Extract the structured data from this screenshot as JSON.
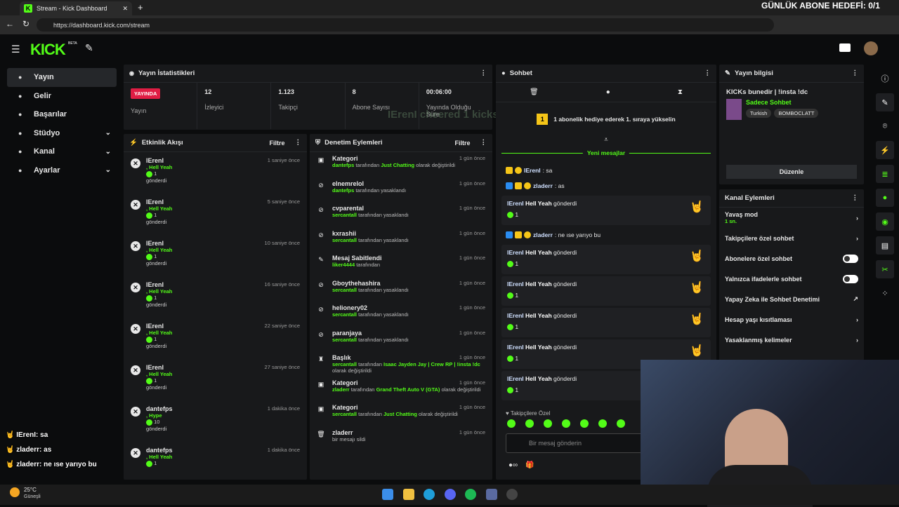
{
  "browser": {
    "tab_title": "Stream - Kick Dashboard",
    "url": "https://dashboard.kick.com/stream"
  },
  "overlay_top": "GÜNLÜK ABONE HEDEFİ: 0/1",
  "overlay_ghost": "IErenI cheered 1 kicks!",
  "logo": "KICK",
  "logo_beta": "BETA",
  "sidebar": [
    {
      "label": "Yayın",
      "icon": "broadcast-icon"
    },
    {
      "label": "Gelir",
      "icon": "wallet-icon"
    },
    {
      "label": "Başarılar",
      "icon": "trophy-icon"
    },
    {
      "label": "Stüdyo",
      "icon": "studio-icon",
      "chev": "⌄"
    },
    {
      "label": "Kanal",
      "icon": "channel-icon",
      "chev": "⌄"
    },
    {
      "label": "Ayarlar",
      "icon": "settings-icon",
      "chev": "⌄"
    }
  ],
  "stats": {
    "title": "Yayın İstatistikleri",
    "live_badge": "YAYINDA",
    "status_label": "Yayın",
    "items": [
      {
        "value": "12",
        "label": "İzleyici"
      },
      {
        "value": "1.123",
        "label": "Takipçi"
      },
      {
        "value": "8",
        "label": "Abone Sayısı"
      },
      {
        "value": "00:06:00",
        "label": "Yayında Olduğu Süre"
      }
    ]
  },
  "activity": {
    "title": "Etkinlik Akışı",
    "filter": "Filtre",
    "events": [
      {
        "name": "IErenI",
        "gift": ", Hell Yeah",
        "count": "1",
        "sent": "gönderdi",
        "time": "1 saniye önce"
      },
      {
        "name": "IErenI",
        "gift": ", Hell Yeah",
        "count": "1",
        "sent": "gönderdi",
        "time": "5 saniye önce"
      },
      {
        "name": "IErenI",
        "gift": ", Hell Yeah",
        "count": "1",
        "sent": "gönderdi",
        "time": "10 saniye önce"
      },
      {
        "name": "IErenI",
        "gift": ", Hell Yeah",
        "count": "1",
        "sent": "gönderdi",
        "time": "16 saniye önce"
      },
      {
        "name": "IErenI",
        "gift": ", Hell Yeah",
        "count": "1",
        "sent": "gönderdi",
        "time": "22 saniye önce"
      },
      {
        "name": "IErenI",
        "gift": ", Hell Yeah",
        "count": "1",
        "sent": "gönderdi",
        "time": "27 saniye önce"
      },
      {
        "name": "dantefps",
        "gift": ", Hype",
        "count": "10",
        "sent": "gönderdi",
        "time": "1 dakika önce"
      },
      {
        "name": "dantefps",
        "gift": ", Hell Yeah",
        "count": "1",
        "sent": "",
        "time": "1 dakika önce"
      }
    ]
  },
  "moderation": {
    "title": "Denetim Eylemleri",
    "filter": "Filtre",
    "actions": [
      {
        "icon": "▣",
        "name": "Kategori",
        "by": "dantefps",
        "text": " tarafından ",
        "hl": "Just Chatting",
        "tail": " olarak değiştirildi",
        "time": "1 gün önce"
      },
      {
        "icon": "⊘",
        "name": "elnemrelol",
        "by": "dantefps",
        "text": " tarafından yasaklandı",
        "hl": "",
        "tail": "",
        "time": "1 gün önce"
      },
      {
        "icon": "⊘",
        "name": "cvparental",
        "by": "sercantall",
        "text": " tarafından yasaklandı",
        "hl": "",
        "tail": "",
        "time": "1 gün önce"
      },
      {
        "icon": "⊘",
        "name": "kxrashii",
        "by": "sercantall",
        "text": " tarafından yasaklandı",
        "hl": "",
        "tail": "",
        "time": "1 gün önce"
      },
      {
        "icon": "✎",
        "name": "Mesaj Sabitlendi",
        "by": "liker4444",
        "text": " tarafından",
        "hl": "",
        "tail": "",
        "time": "1 gün önce"
      },
      {
        "icon": "⊘",
        "name": "Gboythehashira",
        "by": "sercantall",
        "text": " tarafından yasaklandı",
        "hl": "",
        "tail": "",
        "time": "1 gün önce"
      },
      {
        "icon": "⊘",
        "name": "helionery02",
        "by": "sercantall",
        "text": " tarafından yasaklandı",
        "hl": "",
        "tail": "",
        "time": "1 gün önce"
      },
      {
        "icon": "⊘",
        "name": "paranjaya",
        "by": "sercantall",
        "text": " tarafından yasaklandı",
        "hl": "",
        "tail": "",
        "time": "1 gün önce"
      },
      {
        "icon": "♜",
        "name": "Başlık",
        "by": "sercantall",
        "text": " tarafından ",
        "hl": "Isaac Jayden Jay | Crew RP | !insta !dc",
        "tail": " olarak değiştirildi",
        "time": "1 gün önce"
      },
      {
        "icon": "▣",
        "name": "Kategori",
        "by": "zladerr",
        "text": " tarafından ",
        "hl": "Grand Theft Auto V (GTA)",
        "tail": " olarak değiştirildi",
        "time": "1 gün önce"
      },
      {
        "icon": "▣",
        "name": "Kategori",
        "by": "sercantall",
        "text": " tarafından ",
        "hl": "Just Chatting",
        "tail": " olarak değiştirildi",
        "time": "1 gün önce"
      },
      {
        "icon": "🗑",
        "name": "zladerr",
        "by": "",
        "text": "bir mesajı sildi",
        "hl": "",
        "tail": "",
        "time": "1 gün önce"
      }
    ]
  },
  "chat": {
    "title": "Sohbet",
    "gift_banner": "1 abonelik hediye ederek 1. sıraya yükselin",
    "gift_rank": "1",
    "new_messages": "Yeni mesajlar",
    "messages": [
      {
        "user": "IErenI",
        "text": ": sa"
      },
      {
        "user": "zladerr",
        "text": ": as"
      }
    ],
    "gift_cards": [
      {
        "user": "IErenI",
        "item": "Hell Yeah",
        "verb": "gönderdi",
        "count": "1"
      }
    ],
    "mid_message": {
      "user": "zladerr",
      "text": ": ne ıse yarıyo bu"
    },
    "gift_cards2": [
      {
        "user": "IErenI",
        "item": "Hell Yeah",
        "verb": "gönderdi",
        "count": "1"
      },
      {
        "user": "IErenI",
        "item": "Hell Yeah",
        "verb": "gönderdi",
        "count": "1"
      },
      {
        "user": "IErenI",
        "item": "Hell Yeah",
        "verb": "gönderdi",
        "count": "1"
      },
      {
        "user": "IErenI",
        "item": "Hell Yeah",
        "verb": "gönderdi",
        "count": "1"
      },
      {
        "user": "IErenI",
        "item": "Hell Yeah",
        "verb": "gönderdi",
        "count": "1"
      }
    ],
    "followers_label": "Takipçilere Özel",
    "input_placeholder": "Bir mesaj gönderin"
  },
  "stream_info": {
    "title": "Yayın bilgisi",
    "stream_title": "KICKs bunedir | !insta !dc",
    "category": "Sadece Sohbet",
    "tags": [
      "Turkish",
      "BOMBOCLATT"
    ],
    "edit": "Düzenle"
  },
  "channel_actions": {
    "title": "Kanal Eylemleri",
    "items": [
      {
        "label": "Yavaş mod",
        "sub": "1 sn.",
        "type": "chev"
      },
      {
        "label": "Takipçilere özel sohbet",
        "sub": "",
        "type": "chev"
      },
      {
        "label": "Abonelere özel sohbet",
        "sub": "",
        "type": "toggle"
      },
      {
        "label": "Yalnızca ifadelerle sohbet",
        "sub": "",
        "type": "toggle"
      },
      {
        "label": "Yapay Zeka ile Sohbet Denetimi",
        "sub": "",
        "type": "ext"
      },
      {
        "label": "Hesap yaşı kısıtlaması",
        "sub": "",
        "type": "chev"
      },
      {
        "label": "Yasaklanmış kelimeler",
        "sub": "",
        "type": "chev"
      }
    ]
  },
  "overlay_chat": [
    {
      "user": "IErenI",
      "text": ": sa"
    },
    {
      "user": "zladerr",
      "text": ": as"
    },
    {
      "user": "zladerr",
      "text": ": ne ıse yarıyo bu"
    }
  ],
  "weather": {
    "temp": "25°C",
    "desc": "Güneşli"
  },
  "colors": {
    "kick_green": "#53fc18",
    "live_red": "#e01d44"
  }
}
